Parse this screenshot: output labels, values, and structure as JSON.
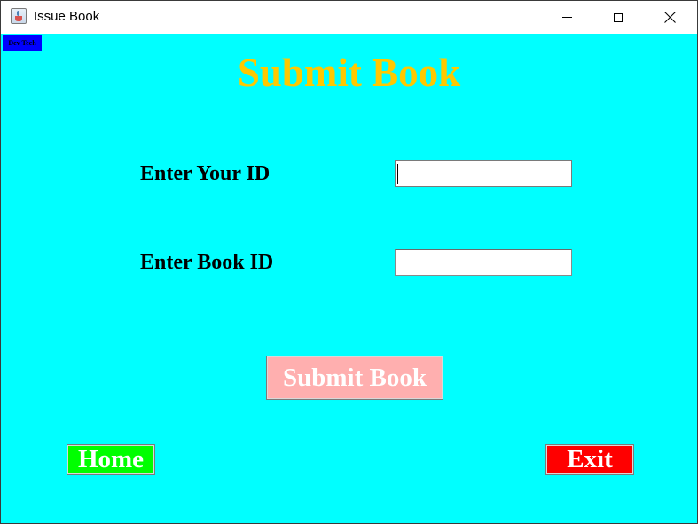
{
  "window": {
    "title": "Issue Book",
    "controls": {
      "minimize_icon": "minimize-icon",
      "maximize_icon": "maximize-icon",
      "close_icon": "close-icon"
    }
  },
  "badge": {
    "text": "Dev Tech",
    "background": "#0000ff"
  },
  "heading": {
    "text": "Submit Book",
    "color": "#ffc800"
  },
  "form": {
    "your_id": {
      "label": "Enter Your ID",
      "value": ""
    },
    "book_id": {
      "label": "Enter Book ID",
      "value": ""
    }
  },
  "buttons": {
    "submit": {
      "label": "Submit Book",
      "background": "#ffafaf"
    },
    "home": {
      "label": "Home",
      "background": "#00ff00"
    },
    "exit": {
      "label": "Exit",
      "background": "#ff0000"
    }
  },
  "colors": {
    "panel_background": "#00ffff"
  }
}
